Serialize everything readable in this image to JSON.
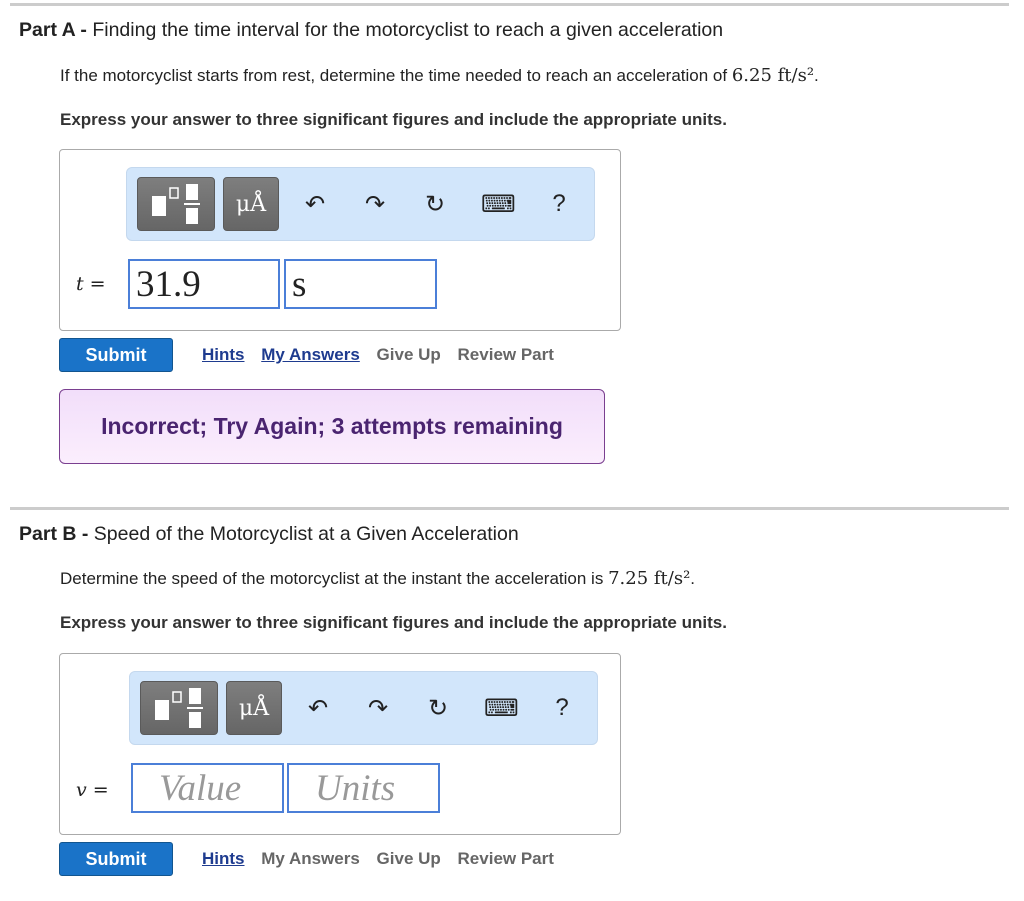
{
  "partA": {
    "label": "Part A -",
    "title": "Finding the time interval for the motorcyclist to reach a given acceleration",
    "prompt": "If the motorcyclist starts from rest, determine the time needed to reach an acceleration of",
    "prompt_math": "6.25 ft/s²",
    "prompt_end": ".",
    "instruction": "Express your answer to three significant figures and include the appropriate units.",
    "variable": "t =",
    "value": "31.9",
    "units": "s",
    "submit_label": "Submit",
    "links": {
      "hints": "Hints",
      "my_answers": "My Answers",
      "give_up": "Give Up",
      "review_part": "Review Part"
    },
    "feedback": "Incorrect; Try Again; 3 attempts remaining"
  },
  "partB": {
    "label": "Part B -",
    "title": "Speed of the Motorcyclist at a Given Acceleration",
    "prompt": "Determine the speed of the motorcyclist at the instant the acceleration is",
    "prompt_math": "7.25 ft/s²",
    "prompt_end": ".",
    "instruction": "Express your answer to three significant figures and include the appropriate units.",
    "variable": "v =",
    "value_placeholder": "Value",
    "units_placeholder": "Units",
    "submit_label": "Submit",
    "links": {
      "hints": "Hints",
      "my_answers": "My Answers",
      "give_up": "Give Up",
      "review_part": "Review Part"
    }
  },
  "toolbar": {
    "templates_icon": "fraction-templates-icon",
    "symbols_label": "μÅ",
    "undo": "↶",
    "redo": "↷",
    "reset": "↻",
    "keyboard": "⌨",
    "help": "?"
  }
}
